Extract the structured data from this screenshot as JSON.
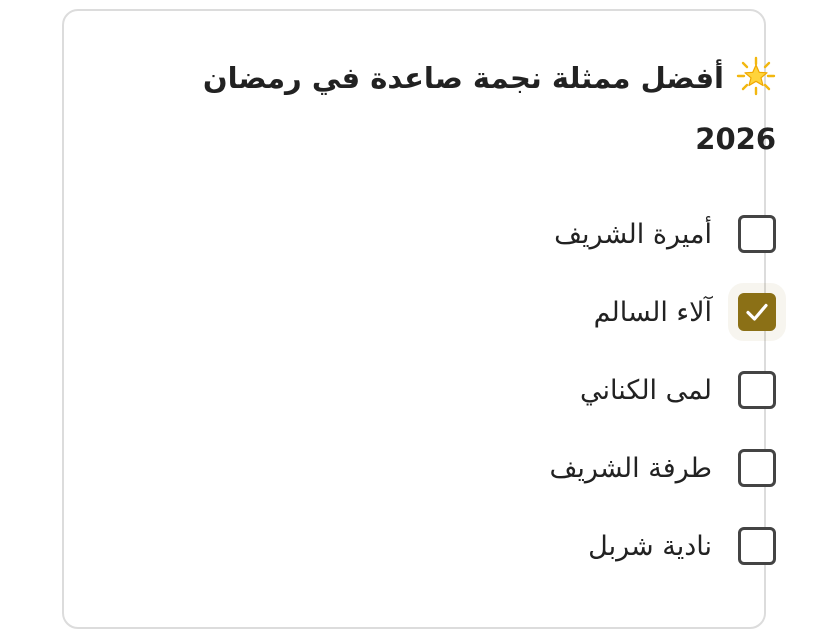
{
  "poll": {
    "title": "أفضل ممثلة نجمة صاعدة في رمضان 2026",
    "title_icon": "glowing-star-icon",
    "accent_color": "#8b7016",
    "options": [
      {
        "label": "أميرة الشريف",
        "checked": false
      },
      {
        "label": "آلاء السالم",
        "checked": true
      },
      {
        "label": "لمى الكناني",
        "checked": false
      },
      {
        "label": "طرفة الشريف",
        "checked": false
      },
      {
        "label": "نادية شربل",
        "checked": false
      }
    ]
  }
}
